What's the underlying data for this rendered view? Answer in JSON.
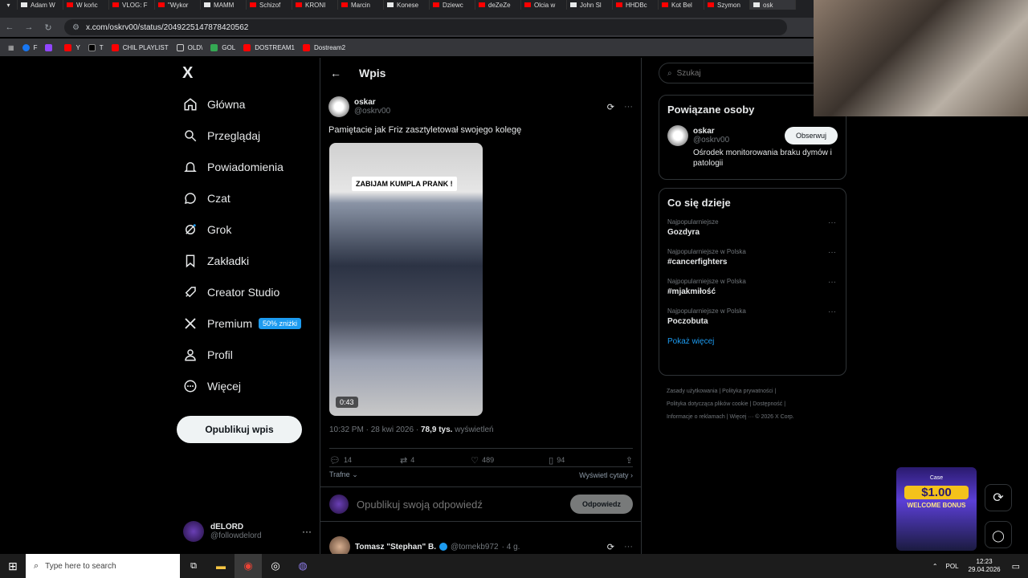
{
  "browser": {
    "tabs": [
      "Adam W",
      "W końc",
      "VLOG: F",
      "\"Wykor",
      "MAMM",
      "Schizof",
      "KRONI",
      "Marcin",
      "Konese",
      "Dziewc",
      "deZeZe",
      "Olcia w",
      "John Sl",
      "HHDBc",
      "Kot Bel",
      "Szymon",
      "osk"
    ],
    "url": "x.com/oskrv00/status/2049225147878420562",
    "bookmarks": [
      "F",
      "Y",
      "T",
      "CHIL PLAYLIST",
      "OLD\\",
      "GOL",
      "DOSTREAM1",
      "Dostream2"
    ]
  },
  "left_nav": {
    "logo": "X",
    "items": [
      {
        "label": "Główna",
        "icon": "home-icon"
      },
      {
        "label": "Przeglądaj",
        "icon": "search-icon"
      },
      {
        "label": "Powiadomienia",
        "icon": "bell-icon"
      },
      {
        "label": "Czat",
        "icon": "chat-icon"
      },
      {
        "label": "Grok",
        "icon": "grok-icon"
      },
      {
        "label": "Zakładki",
        "icon": "bookmark-icon"
      },
      {
        "label": "Creator Studio",
        "icon": "rocket-icon"
      },
      {
        "label": "Premium",
        "icon": "x-icon",
        "badge": "50% zniżki"
      },
      {
        "label": "Profil",
        "icon": "person-icon"
      },
      {
        "label": "Więcej",
        "icon": "more-circle-icon"
      }
    ],
    "publish_label": "Opublikuj wpis",
    "account": {
      "name": "dELORD",
      "handle": "@followdelord"
    }
  },
  "main": {
    "header_title": "Wpis",
    "post": {
      "author_name": "oskar",
      "author_handle": "@oskrv00",
      "text": "Pamiętacie jak Friz zasztyletował swojego kolegę",
      "video_caption": "ZABIJAM KUMPLA PRANK !",
      "video_duration": "0:43",
      "meta_time": "10:32 PM · 28 kwi 2026 · ",
      "meta_views_count": "78,9 tys.",
      "meta_views_label": " wyświetleń",
      "stats": {
        "replies": "14",
        "reposts": "4",
        "likes": "489",
        "bookmarks": "94"
      },
      "sort_label": "Trafne",
      "quotes_label": "Wyświetl cytaty"
    },
    "reply_placeholder": "Opublikuj swoją odpowiedź",
    "reply_button": "Odpowiedz",
    "reply": {
      "author": "Tomasz \"Stephan\" B.",
      "handle": "@tomekb972",
      "time": "· 4 g."
    }
  },
  "right": {
    "search_placeholder": "Szukaj",
    "related_title": "Powiązane osoby",
    "related": {
      "name": "oskar",
      "handle": "@oskrv00",
      "bio": "Ośrodek monitorowania braku dymów i patologii",
      "follow_label": "Obserwuj"
    },
    "trends_title": "Co się dzieje",
    "trends": [
      {
        "category": "Najpopularniejsze",
        "name": "Gozdyra"
      },
      {
        "category": "Najpopularniejsze w Polska",
        "name": "#cancerfighters"
      },
      {
        "category": "Najpopularniejsze w Polska",
        "name": "#mjakmiłość"
      },
      {
        "category": "Najpopularniejsze w Polska",
        "name": "Poczobuta"
      }
    ],
    "show_more": "Pokaż więcej",
    "footer": {
      "line1a": "Zasady użytkowania",
      "line1b": "Polityka prywatności",
      "line2a": "Polityka dotycząca plików cookie",
      "line2b": "Dostępność",
      "line3a": "Informacje o reklamach",
      "line3b": "Więcej ···",
      "line3c": "© 2026 X Corp."
    }
  },
  "overlay_ad": {
    "brand": "Case",
    "amount": "$1.00",
    "bonus": "WELCOME BONUS"
  },
  "taskbar": {
    "search_placeholder": "Type here to search",
    "lang": "POL",
    "time": "12:23",
    "date": "29.04.2026"
  },
  "colors": {
    "accent": "#1d9bf0",
    "bg": "#000000",
    "border": "#2f3336",
    "muted": "#71767b"
  }
}
